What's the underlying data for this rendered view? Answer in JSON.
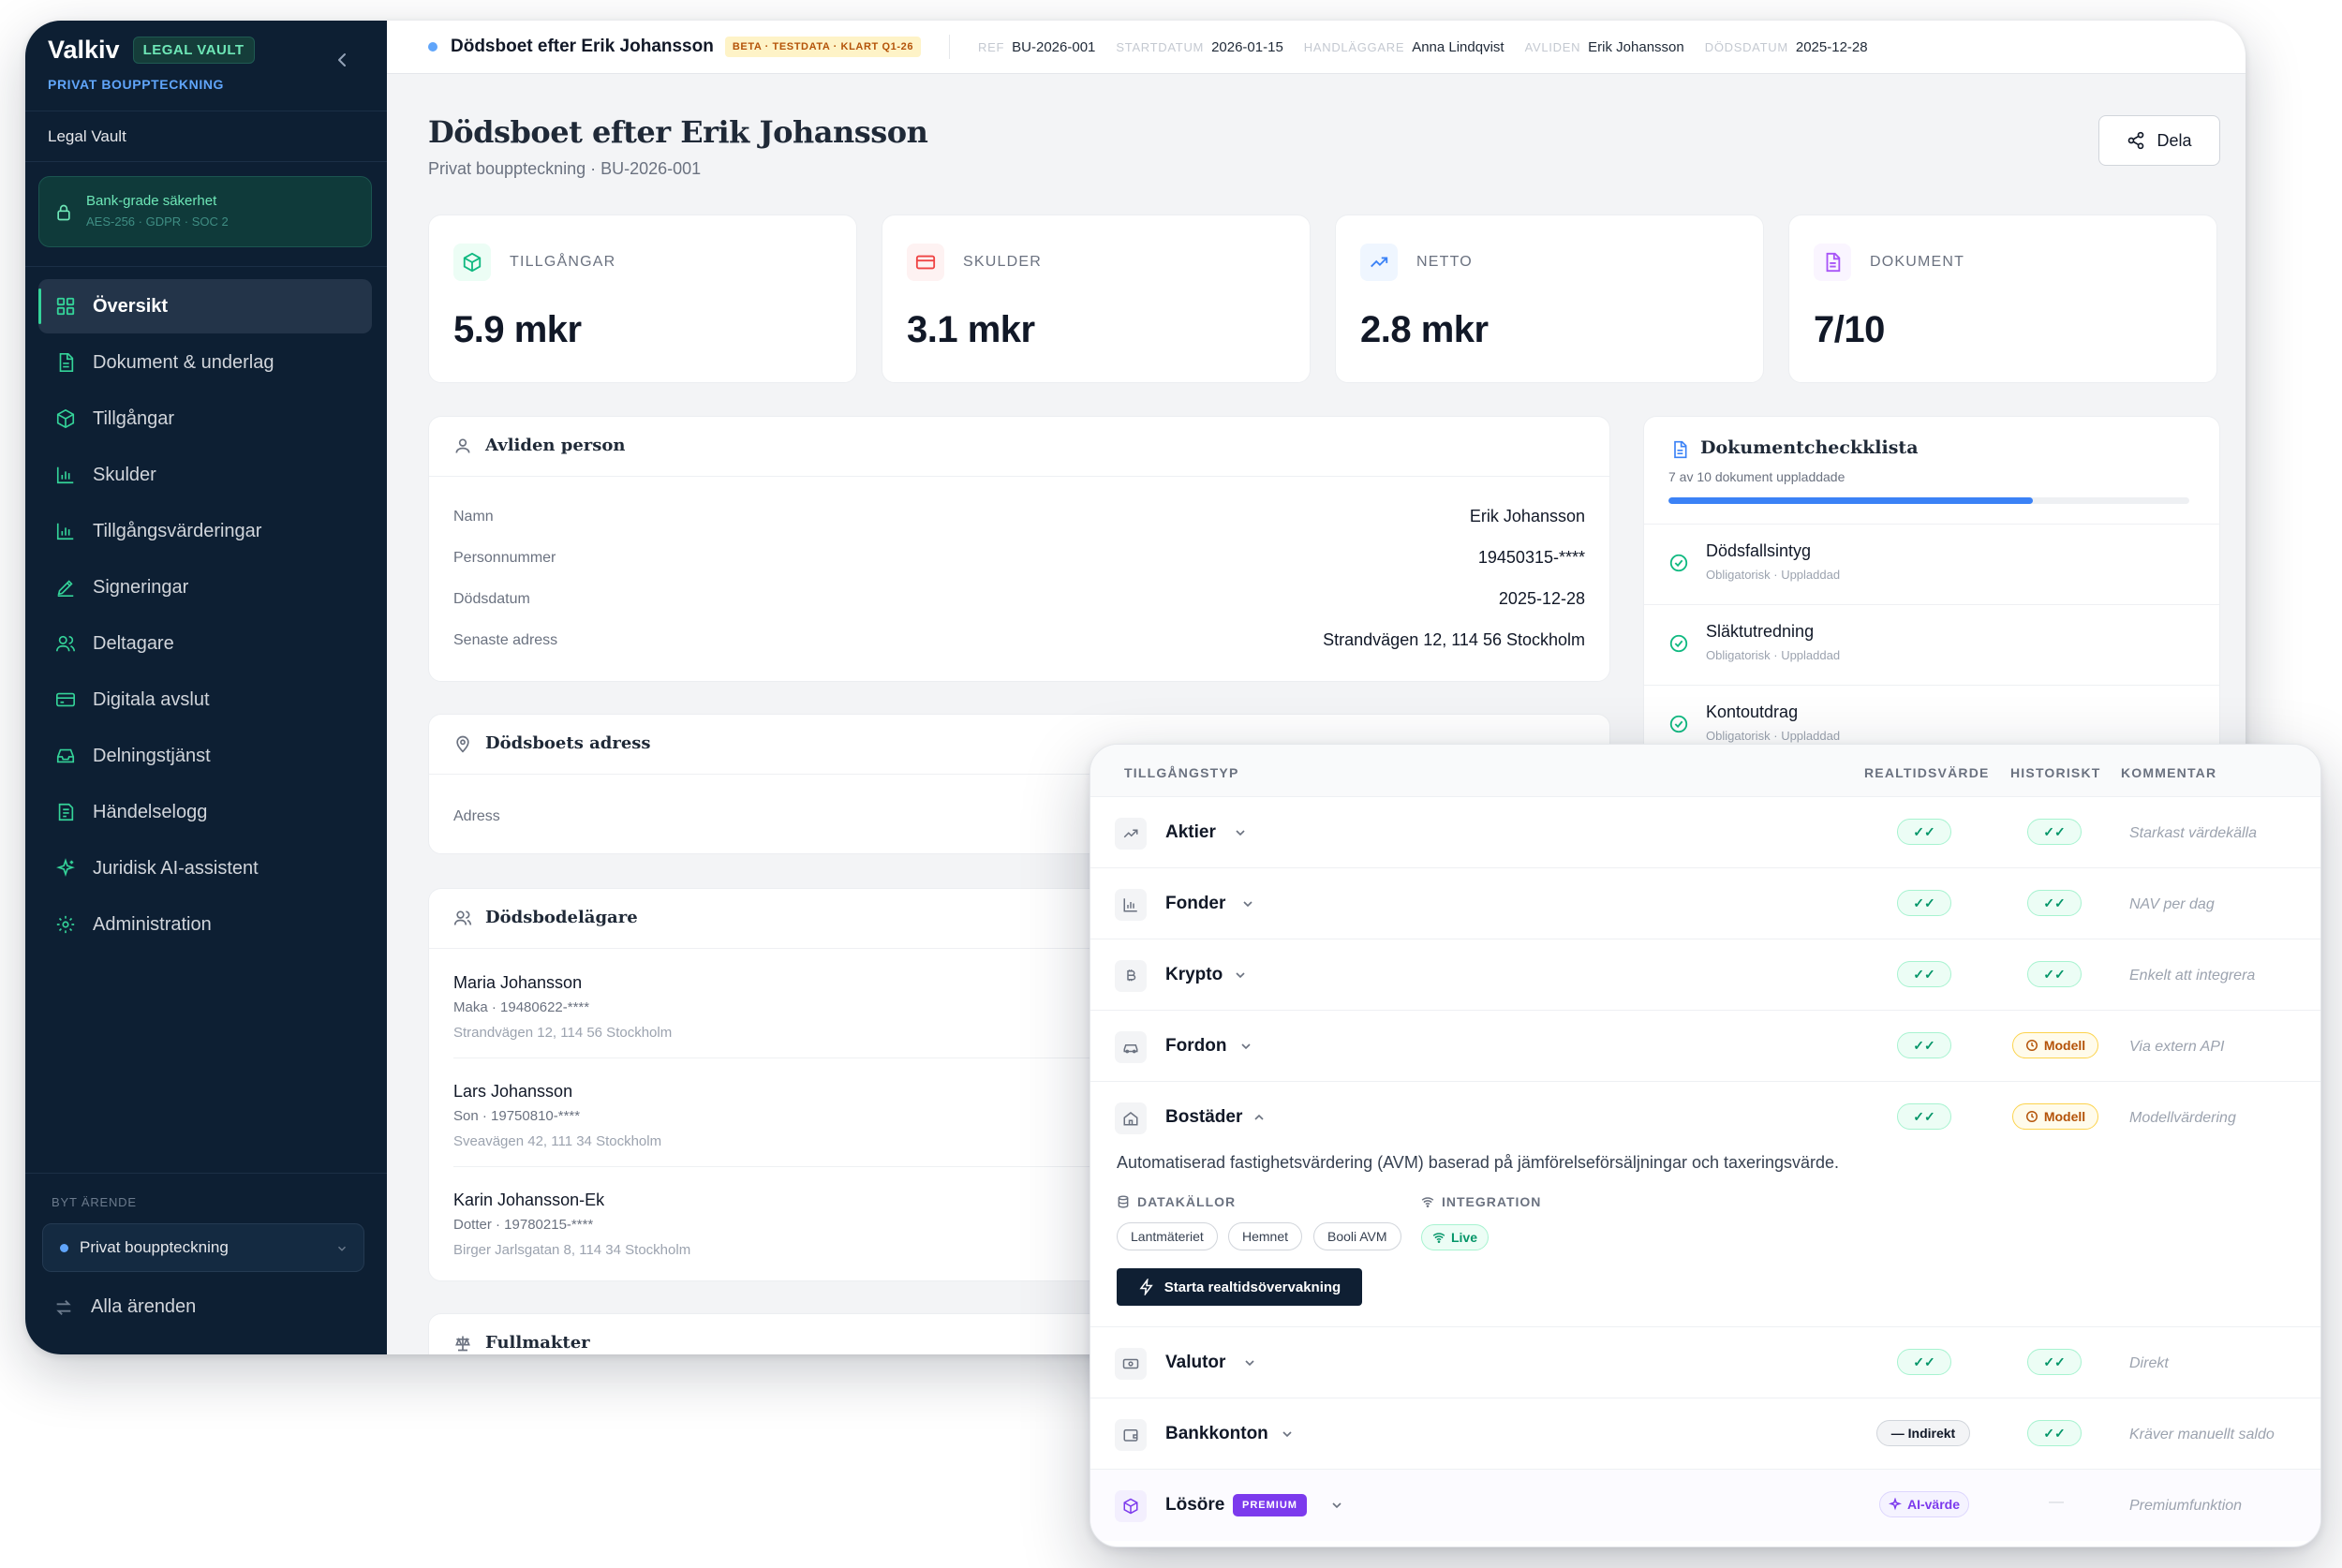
{
  "sidebar": {
    "brand": "Valkiv",
    "badge": "LEGAL VAULT",
    "subtitle": "PRIVAT BOUPPTECKNING",
    "vault": "Legal Vault",
    "security": {
      "title": "Bank-grade säkerhet",
      "details": "AES-256 · GDPR · SOC 2"
    },
    "nav": [
      {
        "label": "Översikt",
        "icon": "grid-icon",
        "active": true
      },
      {
        "label": "Dokument & underlag",
        "icon": "document-icon"
      },
      {
        "label": "Tillgångar",
        "icon": "box-icon"
      },
      {
        "label": "Skulder",
        "icon": "bar-chart-icon"
      },
      {
        "label": "Tillgångsvärderingar",
        "icon": "bar-chart-icon"
      },
      {
        "label": "Signeringar",
        "icon": "signature-icon"
      },
      {
        "label": "Deltagare",
        "icon": "users-icon"
      },
      {
        "label": "Digitala avslut",
        "icon": "id-card-icon"
      },
      {
        "label": "Delningstjänst",
        "icon": "inbox-icon"
      },
      {
        "label": "Händelselogg",
        "icon": "log-icon"
      },
      {
        "label": "Juridisk AI-assistent",
        "icon": "sparkle-icon"
      },
      {
        "label": "Administration",
        "icon": "gear-icon"
      }
    ],
    "switch_label": "BYT ÄRENDE",
    "switch_value": "Privat bouppteckning",
    "all_cases": "Alla ärenden"
  },
  "topbar": {
    "title": "Dödsboet efter Erik Johansson",
    "badge": "BETA · TESTDATA · KLART Q1-26",
    "meta": [
      {
        "key": "REF",
        "value": "BU-2026-001"
      },
      {
        "key": "STARTDATUM",
        "value": "2026-01-15"
      },
      {
        "key": "HANDLÄGGARE",
        "value": "Anna Lindqvist"
      },
      {
        "key": "AVLIDEN",
        "value": "Erik Johansson"
      },
      {
        "key": "DÖDSDATUM",
        "value": "2025-12-28"
      }
    ]
  },
  "page": {
    "title": "Dödsboet efter Erik Johansson",
    "subtitle": "Privat bouppteckning · BU-2026-001",
    "share": "Dela"
  },
  "kpis": [
    {
      "label": "TILLGÅNGAR",
      "value": "5.9 mkr",
      "icon": "box-icon",
      "color": "#10b981"
    },
    {
      "label": "SKULDER",
      "value": "3.1 mkr",
      "icon": "credit-card-icon",
      "color": "#ef4444"
    },
    {
      "label": "NETTO",
      "value": "2.8 mkr",
      "icon": "trend-up-icon",
      "color": "#3b82f6"
    },
    {
      "label": "DOKUMENT",
      "value": "7/10",
      "icon": "document-icon",
      "color": "#a855f7"
    }
  ],
  "deceased": {
    "title": "Avliden person",
    "rows": [
      {
        "k": "Namn",
        "v": "Erik Johansson"
      },
      {
        "k": "Personnummer",
        "v": "19450315-****"
      },
      {
        "k": "Dödsdatum",
        "v": "2025-12-28"
      },
      {
        "k": "Senaste adress",
        "v": "Strandvägen 12, 114 56 Stockholm"
      }
    ]
  },
  "estate_address": {
    "title": "Dödsboets adress",
    "label": "Adress"
  },
  "heirs": {
    "title": "Dödsbodelägare",
    "items": [
      {
        "name": "Maria Johansson",
        "role": "Maka · 19480622-****",
        "address": "Strandvägen 12, 114 56 Stockholm"
      },
      {
        "name": "Lars Johansson",
        "role": "Son · 19750810-****",
        "address": "Sveavägen 42, 111 34 Stockholm"
      },
      {
        "name": "Karin Johansson-Ek",
        "role": "Dotter · 19780215-****",
        "address": "Birger Jarlsgatan 8, 114 34 Stockholm"
      }
    ]
  },
  "powers": {
    "title": "Fullmakter"
  },
  "checklist": {
    "title": "Dokumentcheckklista",
    "subtitle": "7 av 10 dokument uppladdade",
    "progress": 0.7,
    "items": [
      {
        "name": "Dödsfallsintyg",
        "status": "Obligatorisk · Uppladdad"
      },
      {
        "name": "Släktutredning",
        "status": "Obligatorisk · Uppladdad"
      },
      {
        "name": "Kontoutdrag",
        "status": "Obligatorisk · Uppladdad"
      }
    ]
  },
  "asset_panel": {
    "headers": {
      "type": "TILLGÅNGSTYP",
      "realtime": "REALTIDSVÄRDE",
      "historic": "HISTORISKT",
      "comment": "KOMMENTAR"
    },
    "ok_symbol": "✓✓",
    "model_label": "Modell",
    "indirect_label": "— Indirekt",
    "ai_label": "AI-värde",
    "dash": "—",
    "premium": "PREMIUM",
    "rows": [
      {
        "name": "Aktier",
        "icon": "trend-up-icon",
        "realtime": "ok",
        "historic": "ok",
        "comment": "Starkast värdekälla"
      },
      {
        "name": "Fonder",
        "icon": "bar-chart-icon",
        "realtime": "ok",
        "historic": "ok",
        "comment": "NAV per dag"
      },
      {
        "name": "Krypto",
        "icon": "bitcoin-icon",
        "realtime": "ok",
        "historic": "ok",
        "comment": "Enkelt att integrera"
      },
      {
        "name": "Fordon",
        "icon": "car-icon",
        "realtime": "ok",
        "historic": "model",
        "comment": "Via extern API"
      },
      {
        "name": "Bostäder",
        "icon": "home-icon",
        "realtime": "ok",
        "historic": "model",
        "comment": "Modellvärdering"
      },
      {
        "name": "Valutor",
        "icon": "banknote-icon",
        "realtime": "ok",
        "historic": "ok",
        "comment": "Direkt"
      },
      {
        "name": "Bankkonton",
        "icon": "wallet-icon",
        "realtime": "indirect",
        "historic": "ok",
        "comment": "Kräver manuellt saldo"
      },
      {
        "name": "Lösöre",
        "icon": "box-icon",
        "realtime": "ai",
        "historic": "dash",
        "comment": "Premiumfunktion"
      }
    ],
    "expanded": {
      "description": "Automatiserad fastighetsvärdering (AVM) baserad på jämförelseförsäljningar och taxeringsvärde.",
      "sources_label": "DATAKÄLLOR",
      "sources": [
        "Lantmäteriet",
        "Hemnet",
        "Booli AVM"
      ],
      "integration_label": "INTEGRATION",
      "integration_value": "Live",
      "button": "Starta realtidsövervakning"
    }
  }
}
